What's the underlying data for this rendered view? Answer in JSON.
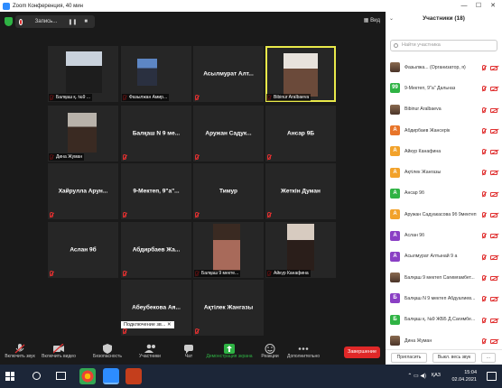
{
  "window": {
    "title": "Zoom Конференция, 40 мин",
    "minimize": "—",
    "maximize": "☐",
    "close": "✕"
  },
  "topbar": {
    "recording_label": "Запись...",
    "pause": "❚❚",
    "stop": "■",
    "view_label": "Вид"
  },
  "tiles": [
    {
      "name": "",
      "label": "Балқаш қ. №9 ...",
      "video": true
    },
    {
      "name": "",
      "label": "Фазылжан Амир...",
      "video": true
    },
    {
      "name": "Асылмурат Алт...",
      "label": "",
      "video": false
    },
    {
      "name": "",
      "label": "Bibinur Aralbaeva",
      "video": true
    },
    {
      "name": "",
      "label": "Дина Жуман",
      "video": true
    },
    {
      "name": "Балқаш N 9 ме...",
      "label": "",
      "video": false
    },
    {
      "name": "Аружан Садук...",
      "label": "",
      "video": false
    },
    {
      "name": "Ансар 9Б",
      "label": "",
      "video": false
    },
    {
      "name": "Хайрулла Арун...",
      "label": "",
      "video": false
    },
    {
      "name": "9-Мектеп, 9\"а\"...",
      "label": "",
      "video": false
    },
    {
      "name": "Тимур",
      "label": "",
      "video": false
    },
    {
      "name": "Жеткін Думан",
      "label": "",
      "video": false
    },
    {
      "name": "Аслан 9б",
      "label": "",
      "video": false
    },
    {
      "name": "Абдирбаев Жа...",
      "label": "",
      "video": false
    },
    {
      "name": "",
      "label": "Балқаш 9 мекте...",
      "video": true
    },
    {
      "name": "",
      "label": "Айкүр Канафина",
      "video": true
    },
    {
      "name": "Абеубекова Ая...",
      "label": "",
      "video": false
    },
    {
      "name": "Ақтілек Жангазы",
      "label": "",
      "video": false
    }
  ],
  "connecting_label": "Подключение зв...",
  "connecting_close": "✕",
  "toolbar": {
    "audio": "Включить звук",
    "video": "Включить видео",
    "security": "Безопасность",
    "participants": "Участники",
    "participants_count": "18",
    "chat": "Чат",
    "share": "Демонстрация экрана",
    "reactions": "Реакции",
    "more": "Дополнительно",
    "end": "Завершение"
  },
  "panel": {
    "title": "Участники (18)",
    "close": "⌄",
    "search_placeholder": "Найти участника",
    "invite": "Пригласить",
    "mute_all": "Выкл. весь звук",
    "more": "..."
  },
  "participants": [
    {
      "initial": "",
      "name": "Фазылжа... (Организатор, я)",
      "color": "#7a5a44",
      "img": true
    },
    {
      "initial": "99",
      "name": "9-Мектеп, 9\"а\" Дальназ",
      "color": "#2fb344",
      "img": false
    },
    {
      "initial": "",
      "name": "Bibinur Aralbaeva",
      "color": "#7a5a44",
      "img": true
    },
    {
      "initial": "А",
      "name": "Абдирбаев Жансерік",
      "color": "#e8752a",
      "img": false
    },
    {
      "initial": "А",
      "name": "Айкүр Канафина",
      "color": "#f2a22b",
      "img": false
    },
    {
      "initial": "А",
      "name": "Ақтілек Жангазы",
      "color": "#f2a22b",
      "img": false
    },
    {
      "initial": "А",
      "name": "Ансар 9б",
      "color": "#2fb344",
      "img": false
    },
    {
      "initial": "А",
      "name": "Аружан Садуакасова 9б 9мектеп",
      "color": "#f2a22b",
      "img": false
    },
    {
      "initial": "А",
      "name": "Аслан 9б",
      "color": "#8a3fc4",
      "img": false
    },
    {
      "initial": "А",
      "name": "Асылмурат Алтынай 9 а",
      "color": "#8a3fc4",
      "img": false
    },
    {
      "initial": "",
      "name": "Балқаш 9 мектеп Сағимғамбет...",
      "color": "#7a5a44",
      "img": true
    },
    {
      "initial": "Б",
      "name": "Балқаш N 9 мектеп Абдуалиев...",
      "color": "#8a3fc4",
      "img": false
    },
    {
      "initial": "Б",
      "name": "Балқаш қ. №9 ЖББ Д.Сағимбе...",
      "color": "#2fb344",
      "img": false
    },
    {
      "initial": "",
      "name": "Дина Жуман",
      "color": "#7a5a44",
      "img": true
    }
  ],
  "taskbar": {
    "lang": "ҚАЗ",
    "time": "15:04",
    "date": "02.04.2021",
    "tray": "⌃ ▭ ◀)"
  }
}
